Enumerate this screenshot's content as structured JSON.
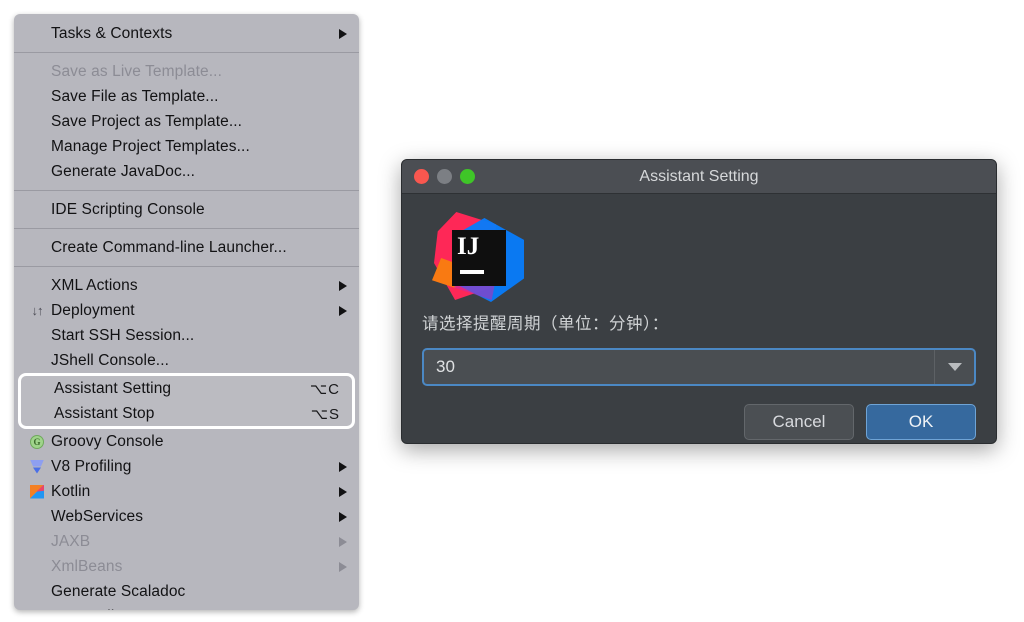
{
  "menu": {
    "sections": [
      {
        "items": [
          {
            "label": "Tasks & Contexts",
            "submenu": true,
            "disabled": false,
            "icon": "",
            "shortcut": ""
          }
        ]
      },
      {
        "items": [
          {
            "label": "Save as Live Template...",
            "submenu": false,
            "disabled": true,
            "icon": "",
            "shortcut": ""
          },
          {
            "label": "Save File as Template...",
            "submenu": false,
            "disabled": false,
            "icon": "",
            "shortcut": ""
          },
          {
            "label": "Save Project as Template...",
            "submenu": false,
            "disabled": false,
            "icon": "",
            "shortcut": ""
          },
          {
            "label": "Manage Project Templates...",
            "submenu": false,
            "disabled": false,
            "icon": "",
            "shortcut": ""
          },
          {
            "label": "Generate JavaDoc...",
            "submenu": false,
            "disabled": false,
            "icon": "",
            "shortcut": ""
          }
        ]
      },
      {
        "items": [
          {
            "label": "IDE Scripting Console",
            "submenu": false,
            "disabled": false,
            "icon": "",
            "shortcut": ""
          }
        ]
      },
      {
        "items": [
          {
            "label": "Create Command-line Launcher...",
            "submenu": false,
            "disabled": false,
            "icon": "",
            "shortcut": ""
          }
        ]
      },
      {
        "items": [
          {
            "label": "XML Actions",
            "submenu": true,
            "disabled": false,
            "icon": "",
            "shortcut": ""
          },
          {
            "label": "Deployment",
            "submenu": true,
            "disabled": false,
            "icon": "deployment-icon",
            "shortcut": ""
          },
          {
            "label": "Start SSH Session...",
            "submenu": false,
            "disabled": false,
            "icon": "",
            "shortcut": ""
          },
          {
            "label": "JShell Console...",
            "submenu": false,
            "disabled": false,
            "icon": "",
            "shortcut": ""
          }
        ]
      }
    ],
    "highlighted_group": {
      "items": [
        {
          "label": "Assistant Setting",
          "shortcut": "⌥C",
          "submenu": false,
          "disabled": false,
          "icon": ""
        },
        {
          "label": "Assistant Stop",
          "shortcut": "⌥S",
          "submenu": false,
          "disabled": false,
          "icon": ""
        }
      ]
    },
    "trailing_items": [
      {
        "label": "Groovy Console",
        "submenu": false,
        "disabled": false,
        "icon": "groovy-icon",
        "shortcut": ""
      },
      {
        "label": "V8 Profiling",
        "submenu": true,
        "disabled": false,
        "icon": "v8-icon",
        "shortcut": ""
      },
      {
        "label": "Kotlin",
        "submenu": true,
        "disabled": false,
        "icon": "kotlin-icon",
        "shortcut": ""
      },
      {
        "label": "WebServices",
        "submenu": true,
        "disabled": false,
        "icon": "",
        "shortcut": ""
      },
      {
        "label": "JAXB",
        "submenu": true,
        "disabled": true,
        "icon": "",
        "shortcut": ""
      },
      {
        "label": "XmlBeans",
        "submenu": true,
        "disabled": true,
        "icon": "",
        "shortcut": ""
      },
      {
        "label": "Generate Scaladoc",
        "submenu": false,
        "disabled": false,
        "icon": "",
        "shortcut": ""
      },
      {
        "label": "HTTP Client",
        "submenu": true,
        "disabled": false,
        "icon": "",
        "shortcut": ""
      }
    ]
  },
  "dialog": {
    "title": "Assistant Setting",
    "logo_text": "IJ",
    "prompt_label": "请选择提醒周期（单位：分钟）：",
    "combo": {
      "value": "30",
      "arrow_icon": "chevron-down-icon"
    },
    "buttons": {
      "cancel": "Cancel",
      "ok": "OK"
    },
    "window_controls": {
      "close": "close-icon",
      "minimize": "minimize-icon",
      "zoom": "zoom-icon"
    }
  },
  "colors": {
    "menu_background": "#b7b7be",
    "menu_text": "#121214",
    "menu_text_disabled": "#8c8c95",
    "highlight_border": "#ffffff",
    "dialog_background": "#3b3f43",
    "dialog_titlebar": "#4b4e53",
    "accent_blue": "#36699e",
    "focus_ring": "#4b88c4",
    "traffic_close": "#f9574f",
    "traffic_min": "#7c7f84",
    "traffic_zoom": "#3fc528"
  }
}
